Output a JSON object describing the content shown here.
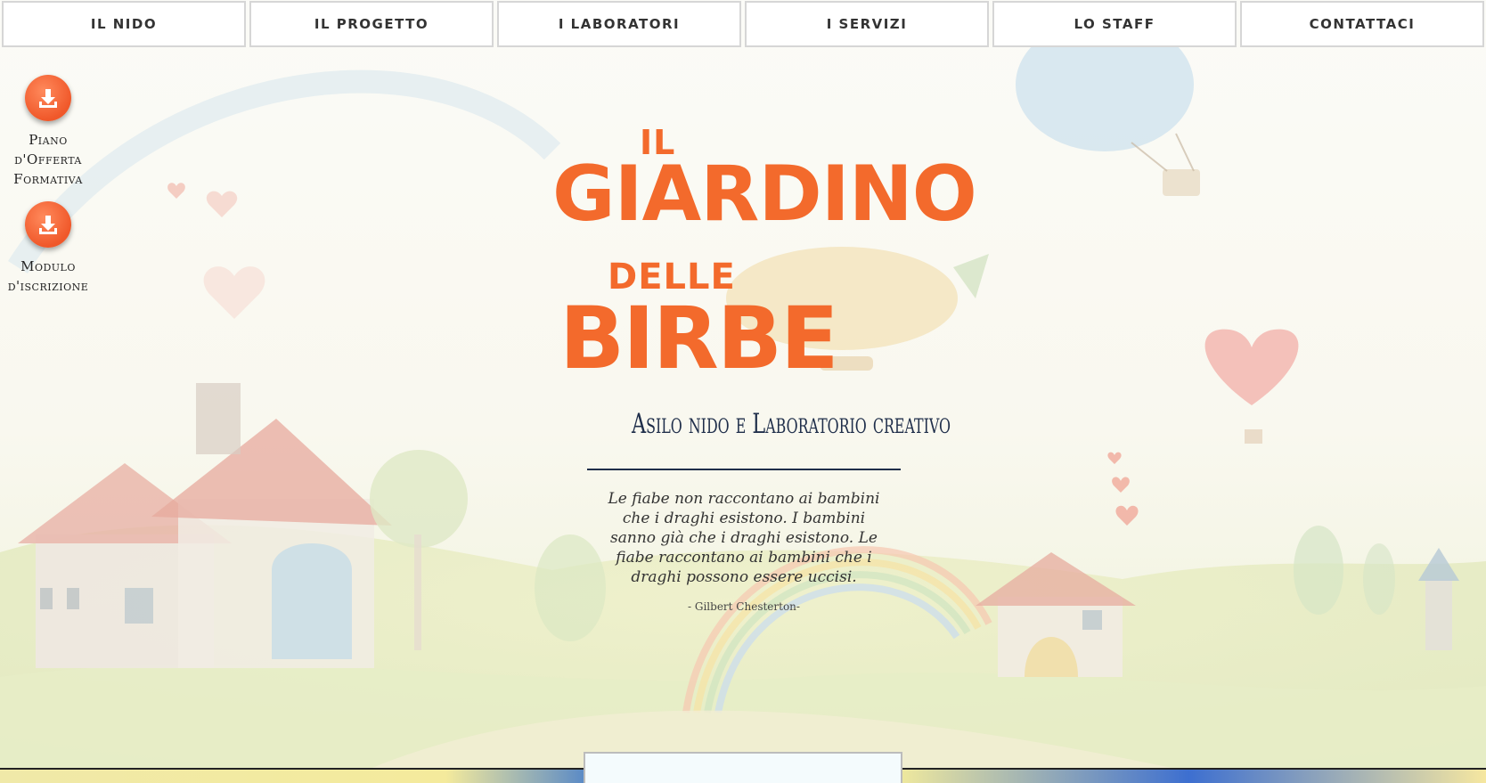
{
  "nav": {
    "items": [
      {
        "label": "IL NIDO"
      },
      {
        "label": "IL PROGETTO"
      },
      {
        "label": "I LABORATORI"
      },
      {
        "label": "I SERVIZI"
      },
      {
        "label": "LO STAFF"
      },
      {
        "label": "CONTATTACI"
      }
    ]
  },
  "downloads": [
    {
      "label_lines": [
        "Piano",
        "d'Offerta",
        "Formativa"
      ],
      "icon": "download-icon"
    },
    {
      "label_lines": [
        "Modulo",
        "d'iscrizione"
      ],
      "icon": "download-icon"
    }
  ],
  "hero": {
    "title": {
      "line1": "IL",
      "line2": "GIARDINO",
      "line3": "DELLE",
      "line4": "BIRBE"
    },
    "subtitle": "Asilo nido e Laboratorio creativo",
    "quote": "Le fiabe non raccontano ai bambini che i draghi esistono. I bambini sanno già che i draghi esistono. Le fiabe raccontano ai bambini che i draghi possono essere uccisi.",
    "author": "- Gilbert Chesterton-"
  },
  "colors": {
    "accent": "#f36a2c",
    "navy": "#1f2e4a",
    "nav_border": "#d6d6d6"
  }
}
